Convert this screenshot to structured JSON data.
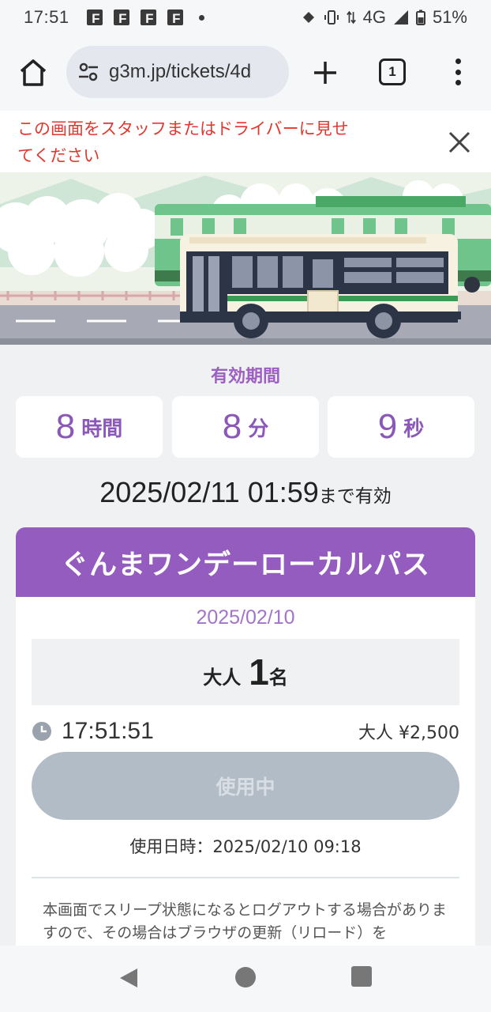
{
  "status_bar": {
    "time": "17:51",
    "notification_icons": [
      "F",
      "F",
      "F",
      "F"
    ],
    "network": "4G",
    "battery": "51%"
  },
  "browser": {
    "url": "g3m.jp/tickets/4d",
    "tab_count": "1"
  },
  "notice": {
    "text": "この画面をスタッフまたはドライバーに見せてください"
  },
  "validity": {
    "label": "有効期間",
    "hours": "8",
    "hours_unit": "時間",
    "minutes": "8",
    "minutes_unit": "分",
    "seconds": "9",
    "seconds_unit": "秒",
    "until_datetime": "2025/02/11 01:59",
    "until_suffix": "まで有効"
  },
  "ticket": {
    "name": "ぐんまワンデーローカルパス",
    "date": "2025/02/10",
    "passenger_label": "大人",
    "passenger_count": "1",
    "passenger_unit": "名",
    "clock_time": "17:51:51",
    "fare": "大人 ¥2,500",
    "status_button": "使用中",
    "used_at": "使用日時：2025/02/10 09:18",
    "footnote": "本画面でスリープ状態になるとログアウトする場合がありますので、その場合はブラウザの更新（リロード）を"
  },
  "colors": {
    "accent_purple": "#945cbe",
    "notice_red": "#e0382e",
    "disabled_button": "#b2bcc6"
  },
  "icons": [
    "home-icon",
    "site-settings-icon",
    "new-tab-icon",
    "tab-switcher-icon",
    "more-menu-icon",
    "close-icon",
    "clock-icon",
    "nav-back-icon",
    "nav-home-icon",
    "nav-recents-icon"
  ]
}
